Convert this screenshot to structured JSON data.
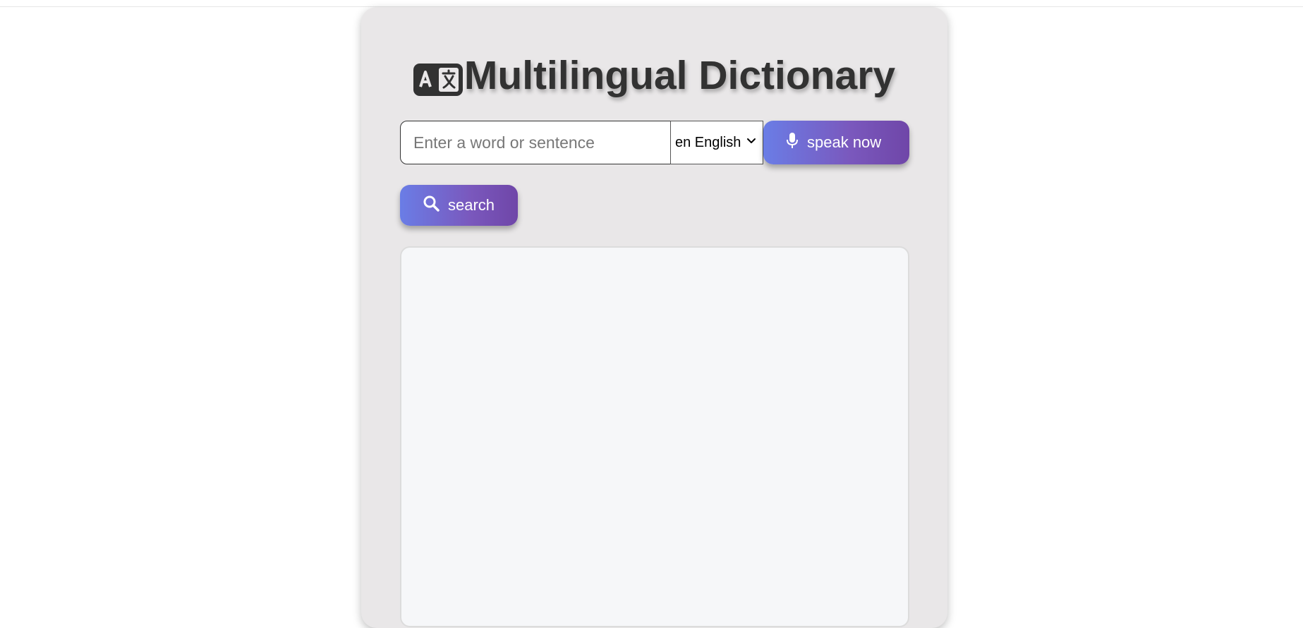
{
  "app": {
    "title": "Multilingual Dictionary",
    "logo_icon": "translate-icon"
  },
  "search": {
    "placeholder": "Enter a word or sentence",
    "value": ""
  },
  "language_select": {
    "selected": "en English",
    "icon": "chevron-down-icon"
  },
  "speak_button": {
    "label": "speak now",
    "icon": "microphone-icon"
  },
  "search_button": {
    "label": "search",
    "icon": "search-icon"
  },
  "results": {
    "content": ""
  },
  "colors": {
    "card_bg": "#e9e7e8",
    "title": "#323232",
    "button_gradient_start": "#6a7de6",
    "button_gradient_end": "#6f46a8",
    "results_bg": "#f6f7f9"
  }
}
